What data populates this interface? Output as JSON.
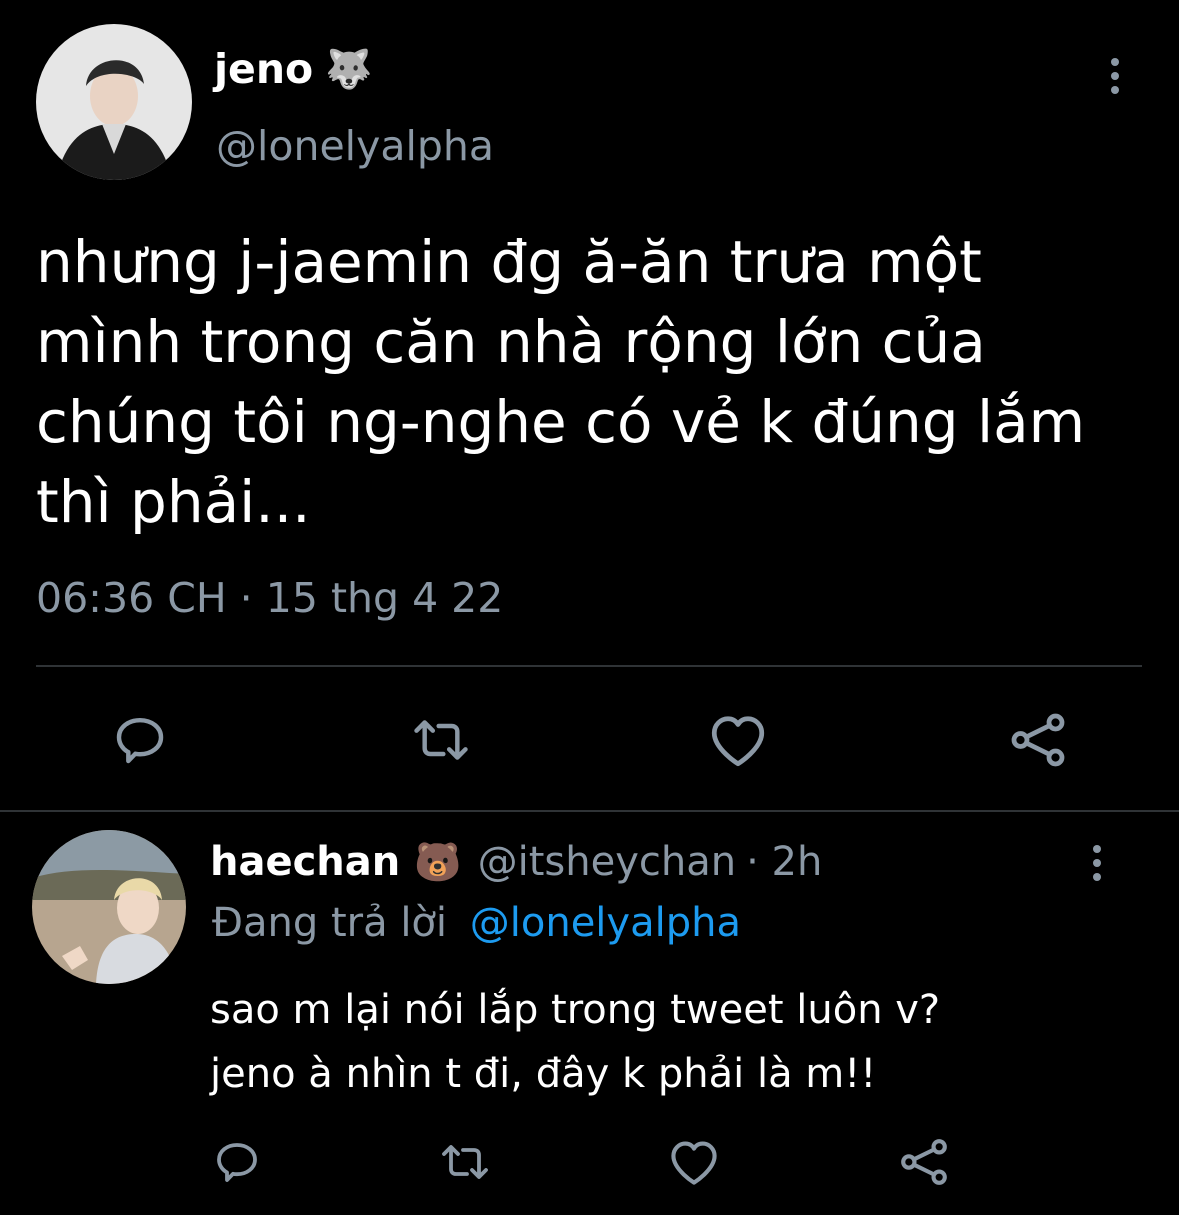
{
  "main_tweet": {
    "display_name": "jeno",
    "name_emoji": "🐺",
    "handle": "@lonelyalpha",
    "text_lines": [
      "nhưng j-jaemin đg ă-ăn trưa một",
      "mình trong căn nhà rộng lớn của",
      "chúng tôi ng-nghe có vẻ k đúng lắm",
      "thì phải..."
    ],
    "timestamp": "06:36 CH · 15 thg 4 22"
  },
  "reply": {
    "display_name": "haechan",
    "name_emoji": "🐻",
    "handle": "@itsheychan",
    "age": "· 2h",
    "replying_prefix": "Đang trả lời",
    "replying_to": "@lonelyalpha",
    "text_lines": [
      "sao m lại nói lắp trong tweet luôn v?",
      "jeno à nhìn t đi, đây k phải là m!!"
    ]
  },
  "colors": {
    "background": "#000000",
    "text": "#ffffff",
    "muted": "#8b98a5",
    "link": "#1d9bf0",
    "divider": "#2f3336"
  },
  "icons": [
    "reply-icon",
    "retweet-icon",
    "like-icon",
    "share-icon",
    "more-options-icon"
  ]
}
